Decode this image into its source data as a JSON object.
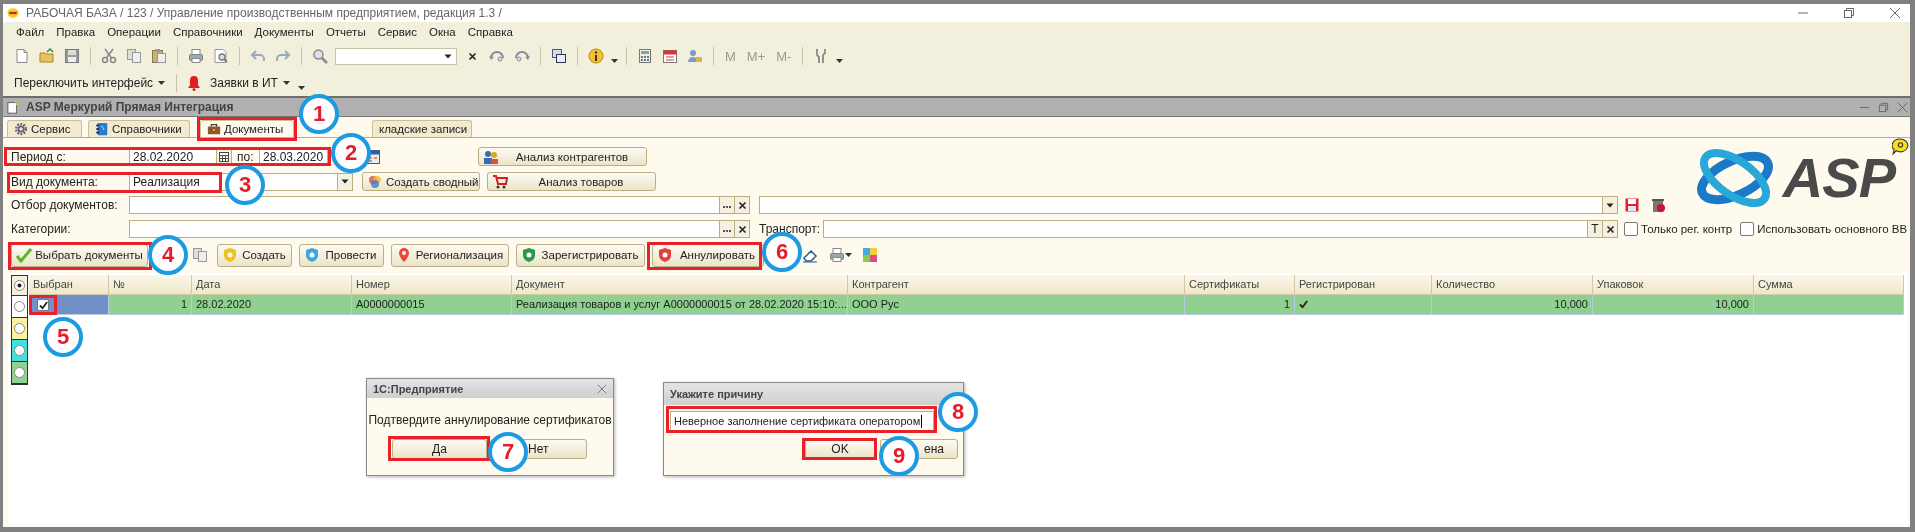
{
  "window": {
    "title": "РАБОЧАЯ БАЗА / 123 /  Управление производственным предприятием, редакция 1.3 /"
  },
  "menu": [
    "Файл",
    "Правка",
    "Операции",
    "Справочники",
    "Документы",
    "Отчеты",
    "Сервис",
    "Окна",
    "Справка"
  ],
  "toolbar": {
    "memory_buttons": [
      "M",
      "M+",
      "M-"
    ]
  },
  "quick_bar": {
    "interface_switch": "Переключить интерфейс",
    "requests": "Заявки в ИТ"
  },
  "form": {
    "title": "ASP Меркурий Прямая Интеграция",
    "tabs": [
      {
        "label": "Сервис",
        "selected": false
      },
      {
        "label": "Справочники",
        "selected": false
      },
      {
        "label": "Документы",
        "selected": true
      },
      {
        "label": "кладские записи",
        "selected": false
      }
    ],
    "period": {
      "label": "Период с:",
      "from": "28.02.2020",
      "to_label": "по:",
      "to": "28.03.2020"
    },
    "doc_type": {
      "label": "Вид документа:",
      "value": "Реализация"
    },
    "filter": {
      "label": "Отбор документов:"
    },
    "categories": {
      "label": "Категории:"
    },
    "transport": {
      "label": "Транспорт:",
      "text_button": "T"
    },
    "options": [
      {
        "label": "Только рег. контр",
        "checked": false
      },
      {
        "label": "Использовать основного ВВ",
        "checked": false
      }
    ],
    "analysis_buttons": [
      "Анализ контрагентов",
      "Анализ товаров"
    ],
    "summary_button": "Создать сводный",
    "logo": "ASP",
    "actions": [
      "Выбрать документы",
      "Создать",
      "Провести",
      "Регионализация",
      "Зарегистрировать",
      "Аннулировать"
    ]
  },
  "legend": [
    {
      "color": "#f5efdc",
      "selected": true
    },
    {
      "color": "#ffffff",
      "selected": false
    },
    {
      "color": "#fdf0a0",
      "selected": false
    },
    {
      "color": "#40e0e0",
      "selected": false
    },
    {
      "color": "#90d090",
      "selected": false
    }
  ],
  "table": {
    "columns": [
      "Выбран",
      "№",
      "Дата",
      "Номер",
      "Документ",
      "Контрагент",
      "Сертификаты",
      "Регистрирован",
      "Количество",
      "Упаковок",
      "Сумма"
    ],
    "rows": [
      {
        "selected": true,
        "checked": true,
        "color": "#90d090",
        "no": "1",
        "date": "28.02.2020",
        "number": "A0000000015",
        "document": "Реализация товаров и услуг A0000000015 от 28.02.2020 15:10:...",
        "counterparty": "ООО Рус",
        "certificates": "1",
        "registered": true,
        "quantity": "10,000",
        "packages": "10,000"
      }
    ]
  },
  "dialogs": [
    {
      "kind": "message",
      "title": "1С:Предприятие",
      "message": "Подтвердите аннулирование сертификатов",
      "buttons": [
        "Да",
        "Нет"
      ]
    },
    {
      "kind": "input",
      "title": "Укажите причину",
      "value": "Неверное заполнение сертификата оператором",
      "buttons": [
        "OK",
        "ена"
      ]
    }
  ],
  "annotations": [
    "1",
    "2",
    "3",
    "4",
    "5",
    "6",
    "7",
    "8",
    "9"
  ]
}
